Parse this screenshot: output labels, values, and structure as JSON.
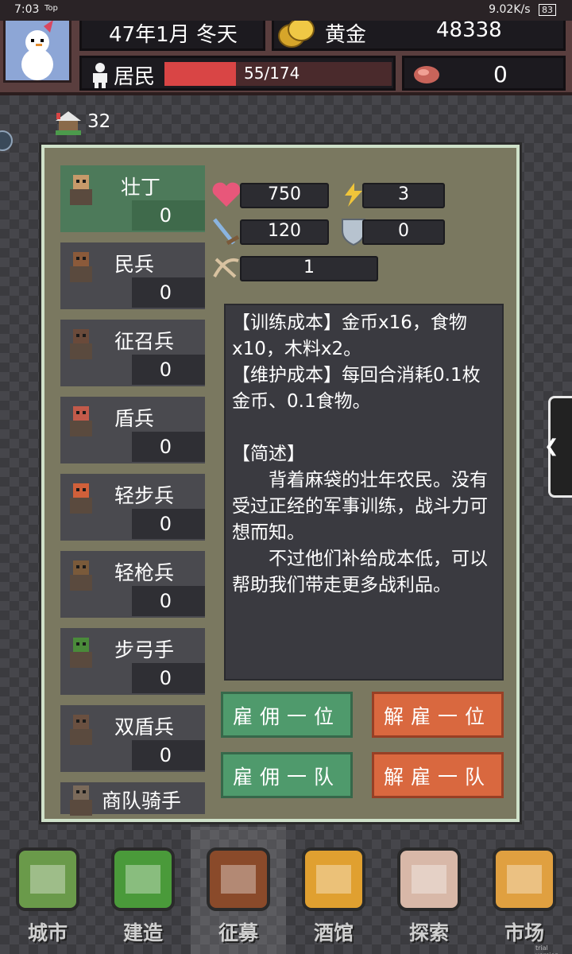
{
  "status_bar": {
    "time": "7:03",
    "top_badge": "Top",
    "network": "9.02K/s",
    "battery": "83"
  },
  "header": {
    "date": "47年1月 冬天",
    "gold_label": "黄金",
    "gold_value": "48338",
    "residents_label": "居民",
    "residents_value": "55/174",
    "residents_fraction": 0.316,
    "food_value": "0",
    "avatar_icon": "snowman-icon",
    "gold_icon": "gold-coins-icon",
    "residents_icon": "person-icon",
    "food_icon": "meat-icon"
  },
  "housing": {
    "icon": "house-icon",
    "count": "32"
  },
  "units": [
    {
      "name": "壮丁",
      "count": "0",
      "icon": "peasant-icon",
      "selected": true
    },
    {
      "name": "民兵",
      "count": "0",
      "icon": "militia-icon"
    },
    {
      "name": "征召兵",
      "count": "0",
      "icon": "conscript-icon"
    },
    {
      "name": "盾兵",
      "count": "0",
      "icon": "shield-soldier-icon"
    },
    {
      "name": "轻步兵",
      "count": "0",
      "icon": "light-infantry-icon"
    },
    {
      "name": "轻枪兵",
      "count": "0",
      "icon": "light-spearman-icon"
    },
    {
      "name": "步弓手",
      "count": "0",
      "icon": "archer-icon"
    },
    {
      "name": "双盾兵",
      "count": "0",
      "icon": "double-shield-icon"
    },
    {
      "name": "商队骑手",
      "count": "",
      "icon": "caravan-rider-icon"
    }
  ],
  "stats": {
    "hp": "750",
    "speed": "3",
    "attack": "120",
    "defense": "0",
    "range": "1",
    "hp_icon": "heart-icon",
    "speed_icon": "lightning-icon",
    "attack_icon": "sword-icon",
    "defense_icon": "shield-icon",
    "range_icon": "crossbow-icon"
  },
  "description": "【训练成本】金币x16，食物x10，木料x2。\n【维护成本】每回合消耗0.1枚金币、0.1食物。\n\n【简述】\n　　背着麻袋的壮年农民。没有受过正经的军事训练，战斗力可想而知。\n　　不过他们补给成本低，可以帮助我们带走更多战利品。",
  "buttons": {
    "hire_one": "雇佣一位",
    "fire_one": "解雇一位",
    "hire_team": "雇佣一队",
    "fire_team": "解雇一队"
  },
  "nav": [
    {
      "label": "城市",
      "icon": "city-icon"
    },
    {
      "label": "建造",
      "icon": "shovel-icon"
    },
    {
      "label": "征募",
      "icon": "sword-shield-icon",
      "active": true
    },
    {
      "label": "酒馆",
      "icon": "beer-icon"
    },
    {
      "label": "探索",
      "icon": "map-icon"
    },
    {
      "label": "市场",
      "icon": "scale-icon"
    }
  ],
  "watermark": "trial version"
}
